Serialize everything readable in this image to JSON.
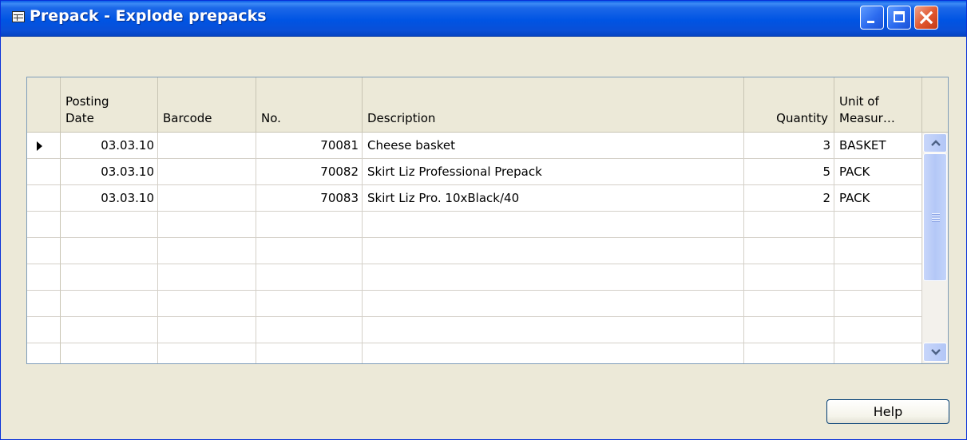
{
  "window": {
    "title": "Prepack - Explode prepacks",
    "icon": "form-icon"
  },
  "columns": {
    "posting_date": [
      "Posting",
      "Date"
    ],
    "barcode": "Barcode",
    "no": "No.",
    "description": "Description",
    "quantity": "Quantity",
    "unit": [
      "Unit of",
      "Measur…"
    ]
  },
  "rows": [
    {
      "posting_date": "03.03.10",
      "barcode": "",
      "no": "70081",
      "description": "Cheese basket",
      "quantity": "3",
      "unit": "BASKET",
      "selected": true
    },
    {
      "posting_date": "03.03.10",
      "barcode": "",
      "no": "70082",
      "description": "Skirt Liz Professional Prepack",
      "quantity": "5",
      "unit": "PACK"
    },
    {
      "posting_date": "03.03.10",
      "barcode": "",
      "no": "70083",
      "description": "Skirt Liz Pro. 10xBlack/40",
      "quantity": "2",
      "unit": "PACK"
    }
  ],
  "empty_row_count": 6,
  "buttons": {
    "help": "Help"
  },
  "colors": {
    "titlebar": "#0054e3",
    "window_bg": "#ece9d8",
    "close_button": "#e0552d"
  }
}
